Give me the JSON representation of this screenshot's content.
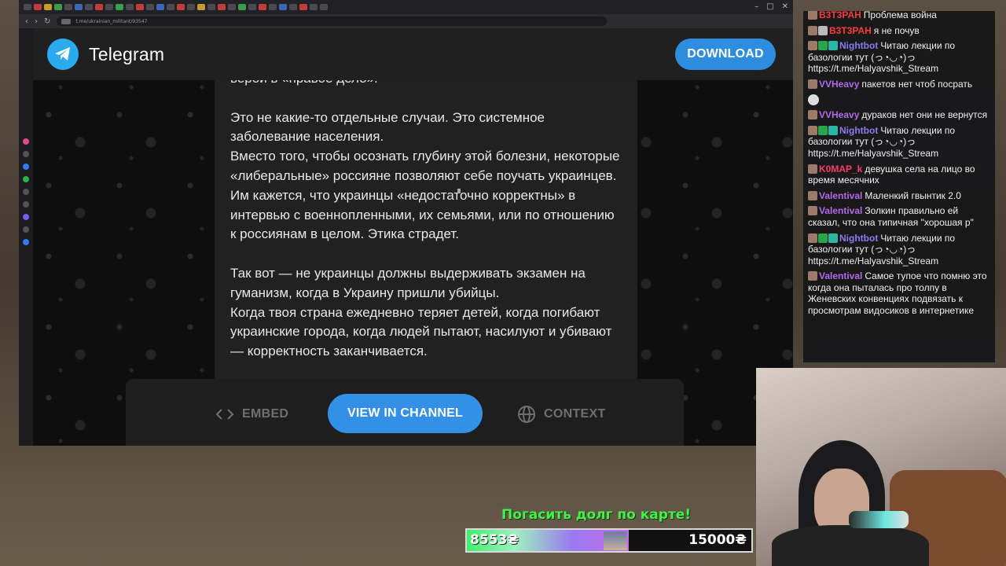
{
  "browser": {
    "url": "t.me/ukrainian_militant/93547",
    "window_controls": [
      "–",
      "□",
      "✕"
    ]
  },
  "telegram": {
    "brand": "Telegram",
    "download_label": "DOWNLOAD",
    "post_paragraphs": [
      "верой в «правое дело».",
      "",
      "Это не какие-то отдельные случаи. Это системное заболевание населения.",
      "Вместо того, чтобы осознать глубину этой болезни, некоторые «либеральные» россияне позволяют себе поучать украинцев.",
      "Им кажется, что украинцы «недостаточно корректны» в интервью с военнопленными, их семьями, или по отношению к россиянам в целом. Этика страдет.",
      "",
      "Так вот — не украинцы должны выдерживать экзамен на гуманизм, когда в Украину пришли убийцы.",
      "Когда твоя страна ежедневно теряет детей, когда погибают украинские города, когда людей пытают, насилуют и убивают — корректность заканчивается."
    ],
    "embed_label": "EMBED",
    "view_label": "VIEW IN CHANNEL",
    "context_label": "CONTEXT",
    "brand_color": "#2AABEE",
    "button_color": "#3390e6"
  },
  "chat": {
    "messages": [
      {
        "nick": "B3T3PAH",
        "color": "#ff3b3b",
        "badges": [
          "p"
        ],
        "text": "Проблема война"
      },
      {
        "nick": "B3T3PAH",
        "color": "#ff3b3b",
        "badges": [
          "p",
          "w"
        ],
        "text": "я не почув"
      },
      {
        "nick": "Nightbot",
        "color": "#8a7cf0",
        "badges": [
          "p",
          "g",
          "t"
        ],
        "text": "Читаю лекции по базологии тут (っ◔◡◔)っ https://t.me/Halyavshik_Stream"
      },
      {
        "nick": "VVHeavy",
        "color": "#b06ae8",
        "badges": [
          "p"
        ],
        "text": "пакетов нет чтоб посрать"
      },
      {
        "nick": "",
        "color": "#ffffff",
        "badges": [],
        "text": "",
        "emote": true
      },
      {
        "nick": "VVHeavy",
        "color": "#b06ae8",
        "badges": [
          "p"
        ],
        "text": "дураков нет они не вернутся"
      },
      {
        "nick": "Nightbot",
        "color": "#8a7cf0",
        "badges": [
          "p",
          "g",
          "t"
        ],
        "text": "Читаю лекции по базологии тут (っ◔◡◔)っ https://t.me/Halyavshik_Stream"
      },
      {
        "nick": "K0MAP_k",
        "color": "#ff3b6a",
        "badges": [
          "p"
        ],
        "text": "девушка села на лицо во время месячних"
      },
      {
        "nick": "Valentival",
        "color": "#b06ae8",
        "badges": [
          "p"
        ],
        "text": "Маленкий гвынтик 2.0"
      },
      {
        "nick": "Valentival",
        "color": "#b06ae8",
        "badges": [
          "p"
        ],
        "text": "Золкин правильно ей сказал, что она типичная \"хорошая р\""
      },
      {
        "nick": "Nightbot",
        "color": "#8a7cf0",
        "badges": [
          "p",
          "g",
          "t"
        ],
        "text": "Читаю лекции по базологии тут (っ◔◡◔)っ https://t.me/Halyavshik_Stream"
      },
      {
        "nick": "Valentival",
        "color": "#b06ae8",
        "badges": [
          "p"
        ],
        "text": "Самое тупое что помню это когда она пыталась про толпу в Женевских конвенциях подвязать к просмотрам видосиков в интернетике"
      }
    ]
  },
  "donation": {
    "title": "Погасить долг по карте!",
    "current": "8553₴",
    "goal": "15000₴",
    "progress": 0.57
  }
}
